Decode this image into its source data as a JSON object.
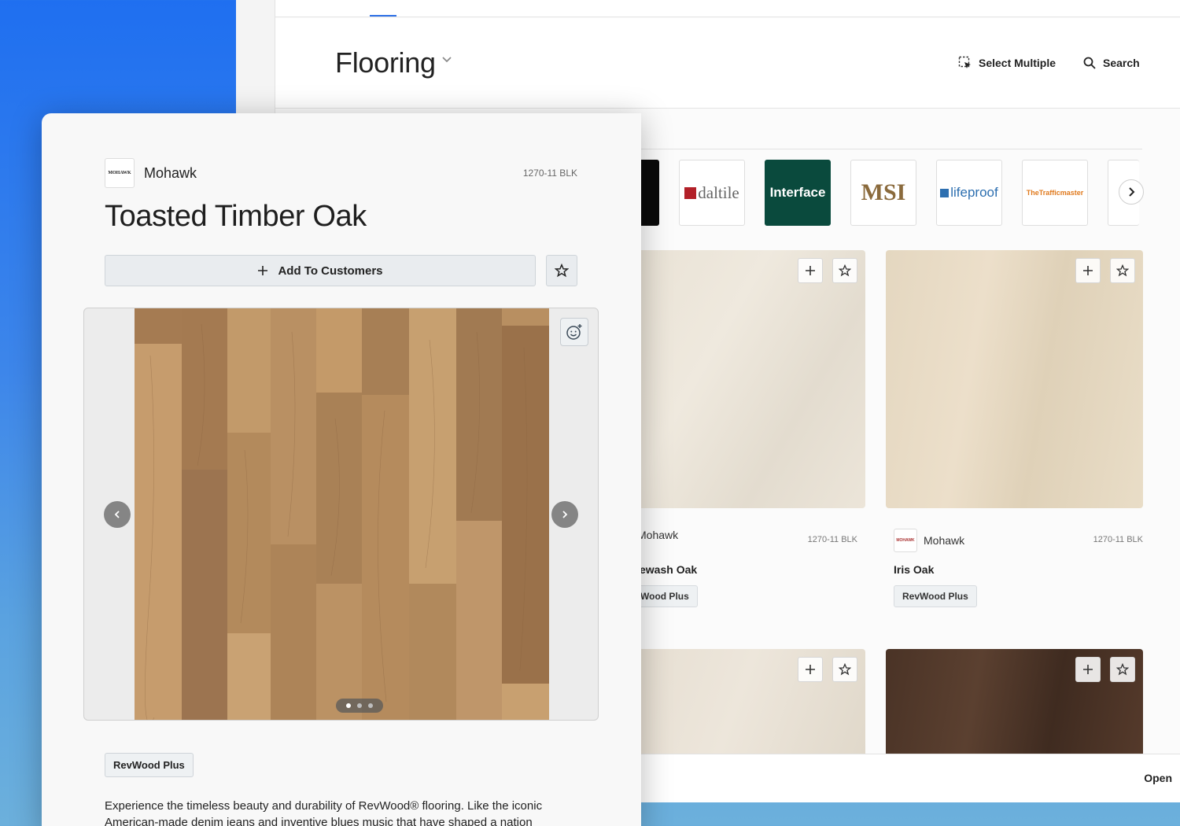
{
  "header": {
    "title": "Flooring",
    "select_multiple_label": "Select Multiple",
    "search_label": "Search"
  },
  "brands": [
    {
      "name": "daltile",
      "icon": "daltile-logo"
    },
    {
      "name": "Interface",
      "icon": "interface-logo"
    },
    {
      "name": "MSI",
      "icon": "msi-logo"
    },
    {
      "name": "lifeproof",
      "icon": "lifeproof-logo"
    },
    {
      "name": "TheTrafficmaster",
      "icon": "trafficmaster-logo"
    }
  ],
  "grid": {
    "tiles": [
      {
        "brand": "Mohawk",
        "code": "1270-11 BLK",
        "name": "ewash Oak",
        "collection": "Wood Plus"
      },
      {
        "brand": "Mohawk",
        "code": "1270-11 BLK",
        "name": "Iris Oak",
        "collection": "RevWood Plus"
      }
    ]
  },
  "footer": {
    "open_label": "Open"
  },
  "detail": {
    "brand": "Mohawk",
    "brand_logo_text": "MOHAWK",
    "code": "1270-11 BLK",
    "title": "Toasted Timber Oak",
    "add_label": "Add To Customers",
    "collection": "RevWood Plus",
    "carousel": {
      "current": 1,
      "total": 3
    },
    "description": "Experience the timeless beauty and durability of RevWood® flooring. Like the iconic American-made denim jeans and inventive blues music that have shaped a nation"
  },
  "colors": {
    "background_blue": "#1f6ff0",
    "accent": "#2c6fe6",
    "interface_green": "#0a4a3d",
    "msi_gold": "#8a6a3c",
    "lifeproof_blue": "#2d6fb0",
    "trafficmaster_orange": "#e07a1e",
    "daltile_red": "#b22028"
  }
}
